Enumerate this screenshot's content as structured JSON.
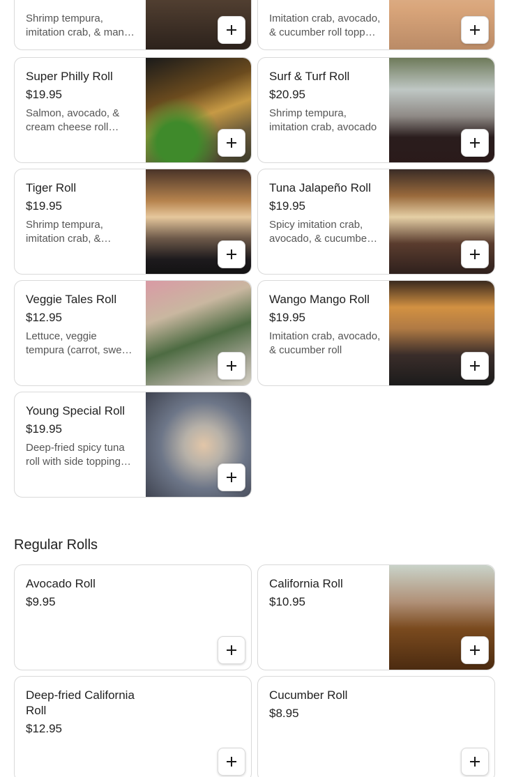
{
  "cards_top": [
    {
      "name": "",
      "price": "",
      "desc": "Shrimp tempura, imitation crab, & mango topped with eel sauce",
      "image": "img-a"
    },
    {
      "name": "",
      "price": "",
      "desc": "Imitation crab, avocado, & cucumber roll topped with",
      "image": "img-b"
    }
  ],
  "specialty_rolls": [
    {
      "name": "Super Philly Roll",
      "price": "$19.95",
      "desc": "Salmon, avocado, & cream cheese roll topped",
      "image": "img-c"
    },
    {
      "name": "Surf & Turf Roll",
      "price": "$20.95",
      "desc": "Shrimp tempura, imitation crab, avocado",
      "image": "img-d"
    },
    {
      "name": "Tiger Roll",
      "price": "$19.95",
      "desc": "Shrimp tempura, imitation crab, & avocado",
      "image": "img-e"
    },
    {
      "name": "Tuna Jalapeño Roll",
      "price": "$19.95",
      "desc": "Spicy imitation crab, avocado, & cucumber roll",
      "image": "img-f"
    },
    {
      "name": "Veggie Tales Roll",
      "price": "$12.95",
      "desc": "Lettuce, veggie tempura (carrot, sweet potato)",
      "image": "img-g"
    },
    {
      "name": "Wango Mango Roll",
      "price": "$19.95",
      "desc": "Imitation crab, avocado, & cucumber roll",
      "image": "img-h"
    },
    {
      "name": "Young Special Roll",
      "price": "$19.95",
      "desc": "Deep-fried spicy tuna roll with side topping sauce",
      "image": "img-i"
    }
  ],
  "regular_section_title": "Regular Rolls",
  "regular_rolls": [
    {
      "name": "Avocado Roll",
      "price": "$9.95"
    },
    {
      "name": "California Roll",
      "price": "$10.95",
      "image": "img-j"
    },
    {
      "name": "Deep-fried California Roll",
      "price": "$12.95"
    },
    {
      "name": "Cucumber Roll",
      "price": "$8.95"
    }
  ],
  "add_button_icon": "plus-icon"
}
